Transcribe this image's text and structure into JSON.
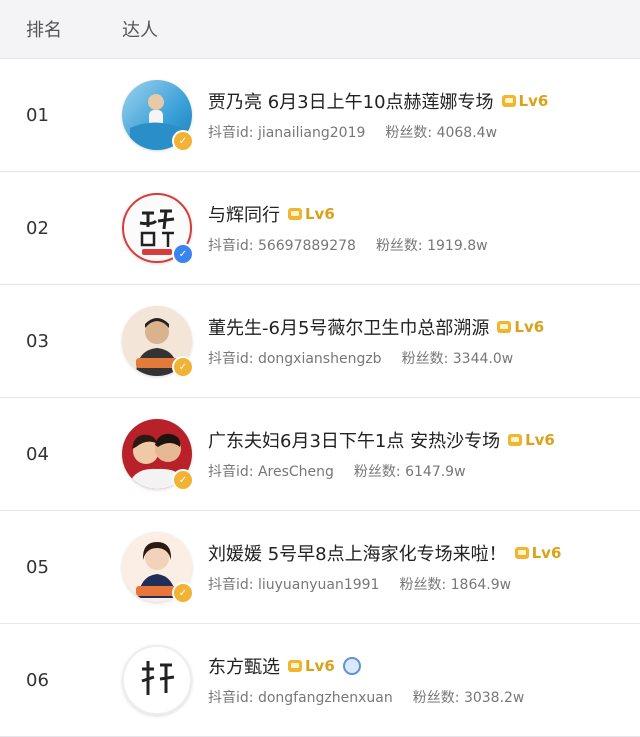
{
  "header": {
    "rank_label": "排名",
    "talent_label": "达人"
  },
  "id_label": "抖音id:",
  "fans_label": "粉丝数:",
  "rows": [
    {
      "rank": "01",
      "name": "贾乃亮 6月3日上午10点赫莲娜专场",
      "level": "Lv6",
      "douyin_id": "jianailiang2019",
      "fans": "4068.4w",
      "badge": "gold"
    },
    {
      "rank": "02",
      "name": "与辉同行",
      "level": "Lv6",
      "douyin_id": "56697889278",
      "fans": "1919.8w",
      "badge": "blue"
    },
    {
      "rank": "03",
      "name": "董先生-6月5号薇尔卫生巾总部溯源",
      "level": "Lv6",
      "douyin_id": "dongxianshengzb",
      "fans": "3344.0w",
      "badge": "gold"
    },
    {
      "rank": "04",
      "name": "广东夫妇6月3日下午1点 安热沙专场",
      "level": "Lv6",
      "douyin_id": "AresCheng",
      "fans": "6147.9w",
      "badge": "gold"
    },
    {
      "rank": "05",
      "name": "刘媛媛 5号早8点上海家化专场来啦！",
      "level": "Lv6",
      "douyin_id": "liuyuanyuan1991",
      "fans": "1864.9w",
      "badge": "gold"
    },
    {
      "rank": "06",
      "name": "东方甄选",
      "level": "Lv6",
      "douyin_id": "dongfangzhenxuan",
      "fans": "3038.2w",
      "badge": "none"
    }
  ],
  "colors": {
    "level_gold": "#d9a21a",
    "badge_gold": "#f2b233",
    "badge_blue": "#3a84f2"
  }
}
